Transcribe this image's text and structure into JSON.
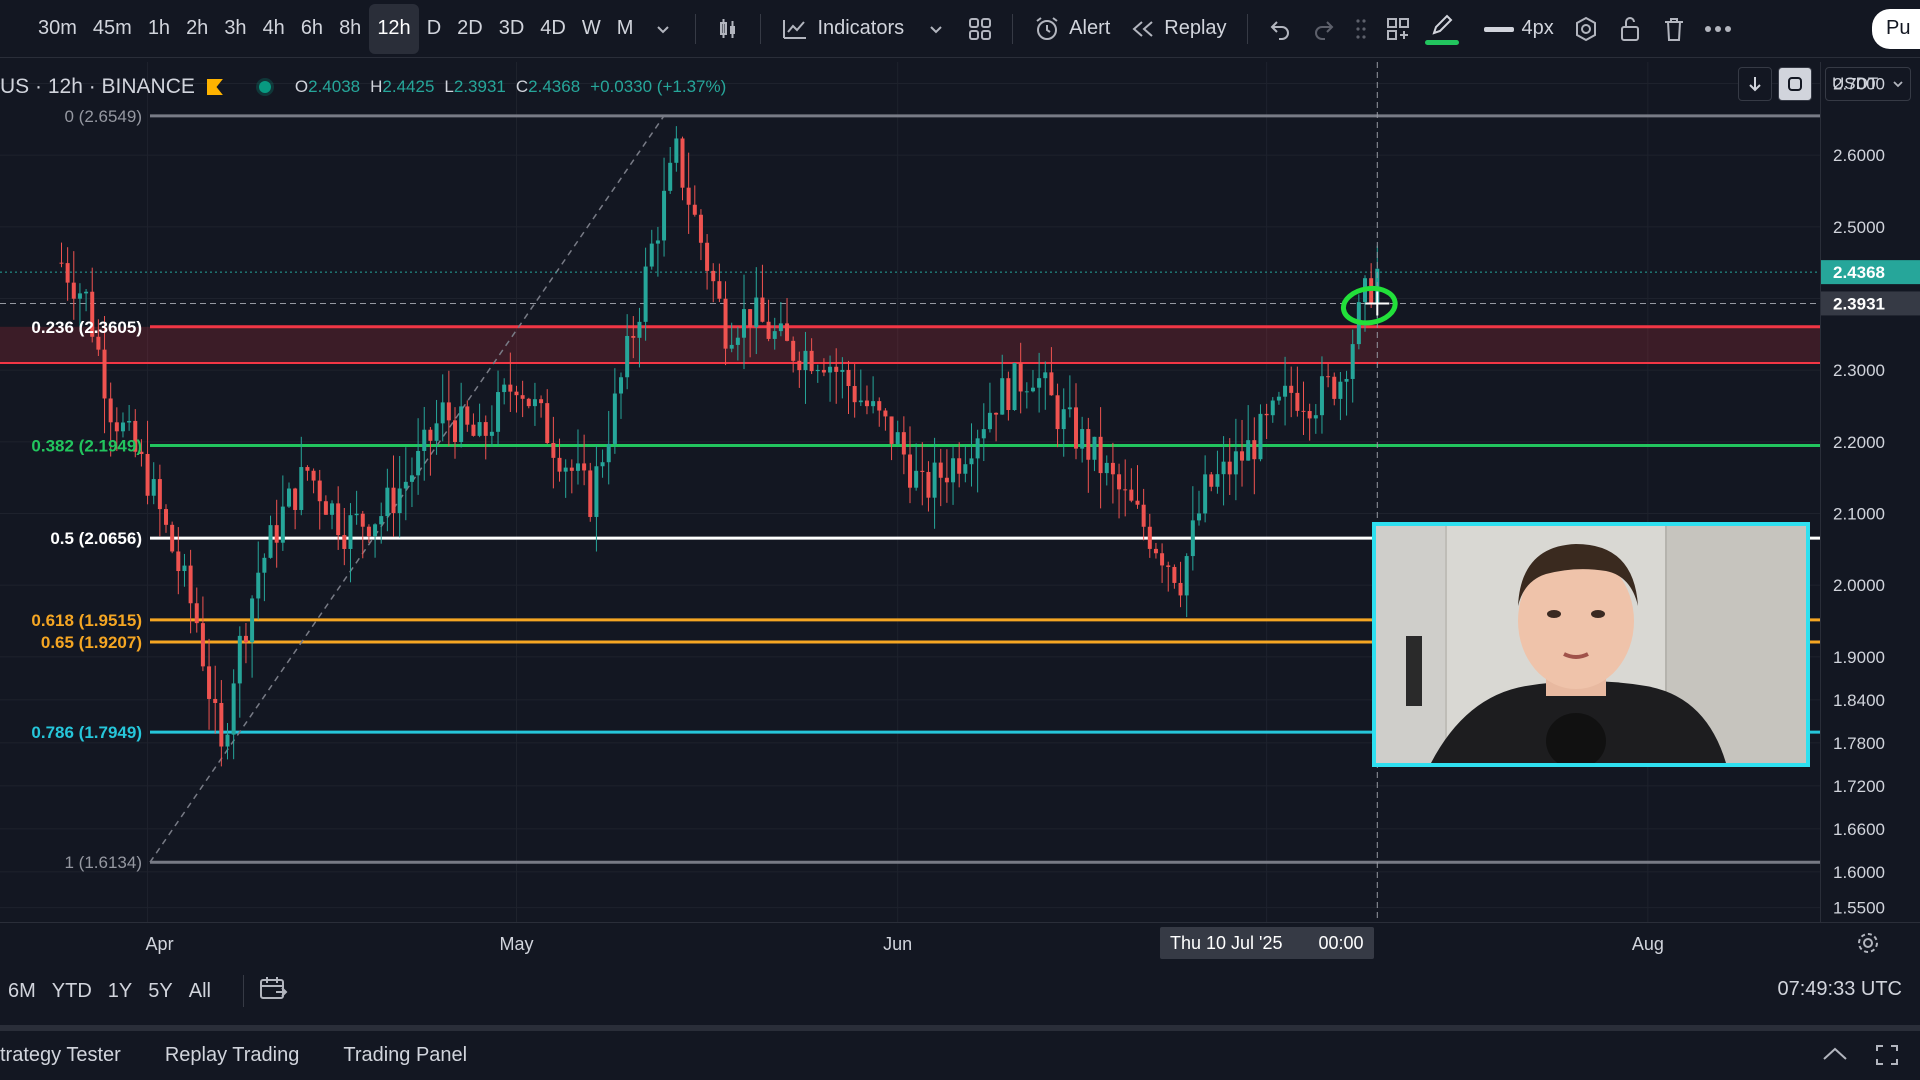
{
  "toolbar": {
    "intervals": [
      "30m",
      "45m",
      "1h",
      "2h",
      "3h",
      "4h",
      "6h",
      "8h",
      "12h",
      "D",
      "2D",
      "3D",
      "4D",
      "W",
      "M"
    ],
    "active_interval": "12h",
    "indicators_label": "Indicators",
    "alert_label": "Alert",
    "replay_label": "Replay",
    "line_width_label": "4px",
    "publish_label": "Pu",
    "icons": [
      "chevron-down-icon",
      "candles-icon",
      "indicators-icon",
      "layout-grid-icon",
      "alert-clock-icon",
      "replay-icon",
      "undo-icon",
      "redo-icon",
      "drag-handle-icon",
      "templates-icon",
      "pencil-icon",
      "line-icon",
      "visibility-icon",
      "lock-icon",
      "trash-icon",
      "more-icon"
    ],
    "pencil_color": "#22c55e"
  },
  "symbol": {
    "name": "US · 12h · BINANCE",
    "open_label": "O",
    "open": "2.4038",
    "high_label": "H",
    "high": "2.4425",
    "low_label": "L",
    "low": "2.3931",
    "close_label": "C",
    "close": "2.4368",
    "change": "+0.0330 (+1.37%)"
  },
  "price_axis": {
    "currency": "USDT",
    "current_price": "2.4368",
    "crosshair_price": "2.3931",
    "current_color": "#26a69a",
    "ticks": [
      "2.7000",
      "2.6000",
      "2.5000",
      "2.4000",
      "2.3000",
      "2.2000",
      "2.1000",
      "2.0000",
      "1.9000",
      "1.8400",
      "1.7800",
      "1.7200",
      "1.6600",
      "1.6000",
      "1.5500"
    ]
  },
  "fib_levels": [
    {
      "label": "0 (2.6549)",
      "value": 2.6549,
      "color": "#787b86"
    },
    {
      "label": "0.236 (2.3605)",
      "value": 2.3605,
      "color": "#f23645"
    },
    {
      "label": "0.382 (2.1949)",
      "value": 2.1949,
      "color": "#22c55e"
    },
    {
      "label": "0.5 (2.0656)",
      "value": 2.0656,
      "color": "#ffffff"
    },
    {
      "label": "0.618 (1.9515)",
      "value": 1.9515,
      "color": "#f5a623"
    },
    {
      "label": "0.65 (1.9207)",
      "value": 1.9207,
      "color": "#f5a623"
    },
    {
      "label": "0.786 (1.7949)",
      "value": 1.7949,
      "color": "#26c6da"
    },
    {
      "label": "1 (1.6134)",
      "value": 1.6134,
      "color": "#787b86"
    }
  ],
  "time_axis": {
    "labels": [
      {
        "text": "Apr",
        "date": "2025-04-01"
      },
      {
        "text": "May",
        "date": "2025-05-01"
      },
      {
        "text": "Jun",
        "date": "2025-06-01"
      },
      {
        "text": "Ju",
        "date": "2025-07-01"
      },
      {
        "text": "Aug",
        "date": "2025-08-01"
      }
    ],
    "crosshair_date": "Thu 10 Jul '25",
    "crosshair_time": "00:00"
  },
  "range_bar": {
    "ranges": [
      "6M",
      "YTD",
      "1Y",
      "5Y",
      "All"
    ],
    "clock": "07:49:33 UTC"
  },
  "bottom_tabs": [
    "trategy Tester",
    "Replay Trading",
    "Trading Panel"
  ],
  "chart_data": {
    "type": "candlestick",
    "x_start": "2025-03-20",
    "x_end": "2025-08-15",
    "ylim": [
      1.53,
      2.73
    ],
    "close_series": [
      [
        "2025-03-25",
        2.45
      ],
      [
        "2025-03-27",
        2.4
      ],
      [
        "2025-03-29",
        2.25
      ],
      [
        "2025-04-01",
        2.15
      ],
      [
        "2025-04-03",
        2.05
      ],
      [
        "2025-04-05",
        1.95
      ],
      [
        "2025-04-07",
        1.76
      ],
      [
        "2025-04-08",
        1.88
      ],
      [
        "2025-04-10",
        2.02
      ],
      [
        "2025-04-12",
        2.1
      ],
      [
        "2025-04-14",
        2.16
      ],
      [
        "2025-04-17",
        2.08
      ],
      [
        "2025-04-20",
        2.1
      ],
      [
        "2025-04-23",
        2.17
      ],
      [
        "2025-04-25",
        2.24
      ],
      [
        "2025-04-28",
        2.2
      ],
      [
        "2025-05-01",
        2.29
      ],
      [
        "2025-05-04",
        2.2
      ],
      [
        "2025-05-07",
        2.12
      ],
      [
        "2025-05-09",
        2.25
      ],
      [
        "2025-05-11",
        2.39
      ],
      [
        "2025-05-12",
        2.47
      ],
      [
        "2025-05-14",
        2.6
      ],
      [
        "2025-05-16",
        2.48
      ],
      [
        "2025-05-18",
        2.36
      ],
      [
        "2025-05-20",
        2.38
      ],
      [
        "2025-05-23",
        2.33
      ],
      [
        "2025-05-26",
        2.32
      ],
      [
        "2025-05-29",
        2.26
      ],
      [
        "2025-06-01",
        2.2
      ],
      [
        "2025-06-03",
        2.13
      ],
      [
        "2025-06-06",
        2.18
      ],
      [
        "2025-06-09",
        2.26
      ],
      [
        "2025-06-12",
        2.3
      ],
      [
        "2025-06-14",
        2.24
      ],
      [
        "2025-06-17",
        2.18
      ],
      [
        "2025-06-19",
        2.13
      ],
      [
        "2025-06-22",
        2.06
      ],
      [
        "2025-06-24",
        2.01
      ],
      [
        "2025-06-26",
        2.13
      ],
      [
        "2025-06-29",
        2.18
      ],
      [
        "2025-07-01",
        2.22
      ],
      [
        "2025-07-03",
        2.27
      ],
      [
        "2025-07-05",
        2.26
      ],
      [
        "2025-07-07",
        2.29
      ],
      [
        "2025-07-09",
        2.4
      ],
      [
        "2025-07-10",
        2.4368
      ]
    ]
  },
  "webcam": {
    "border_color": "#2fe0f0"
  }
}
